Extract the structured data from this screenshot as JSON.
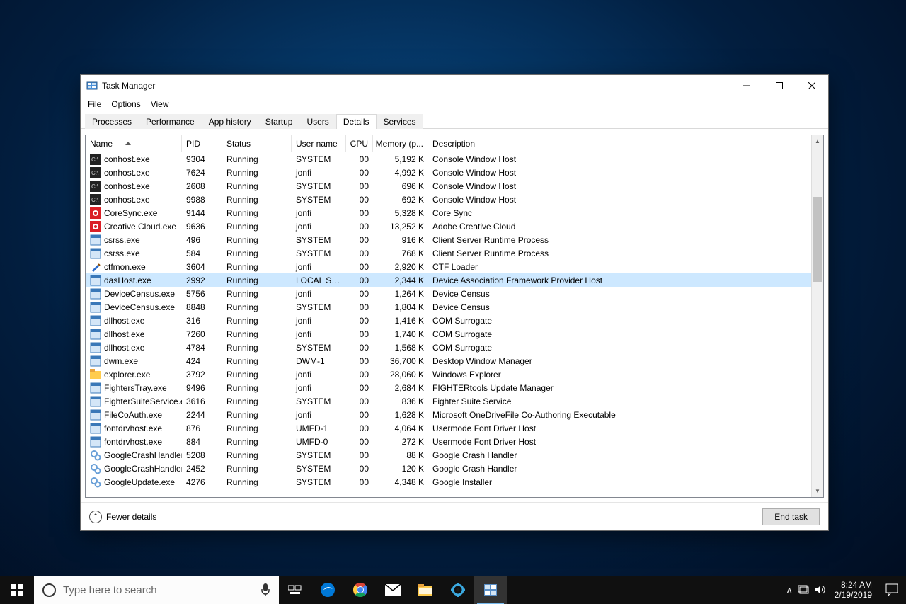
{
  "window": {
    "title": "Task Manager",
    "menu": [
      "File",
      "Options",
      "View"
    ],
    "tabs": [
      "Processes",
      "Performance",
      "App history",
      "Startup",
      "Users",
      "Details",
      "Services"
    ],
    "active_tab": 5,
    "columns": [
      "Name",
      "PID",
      "Status",
      "User name",
      "CPU",
      "Memory (p...",
      "Description"
    ],
    "sort_col": 0,
    "selected_row": 9,
    "fewer": "Fewer details",
    "end_task": "End task",
    "rows": [
      {
        "icon": "console",
        "name": "conhost.exe",
        "pid": "9304",
        "status": "Running",
        "user": "SYSTEM",
        "cpu": "00",
        "mem": "5,192 K",
        "desc": "Console Window Host"
      },
      {
        "icon": "console",
        "name": "conhost.exe",
        "pid": "7624",
        "status": "Running",
        "user": "jonfi",
        "cpu": "00",
        "mem": "4,992 K",
        "desc": "Console Window Host"
      },
      {
        "icon": "console",
        "name": "conhost.exe",
        "pid": "2608",
        "status": "Running",
        "user": "SYSTEM",
        "cpu": "00",
        "mem": "696 K",
        "desc": "Console Window Host"
      },
      {
        "icon": "console",
        "name": "conhost.exe",
        "pid": "9988",
        "status": "Running",
        "user": "SYSTEM",
        "cpu": "00",
        "mem": "692 K",
        "desc": "Console Window Host"
      },
      {
        "icon": "adobe-red",
        "name": "CoreSync.exe",
        "pid": "9144",
        "status": "Running",
        "user": "jonfi",
        "cpu": "00",
        "mem": "5,328 K",
        "desc": "Core Sync"
      },
      {
        "icon": "adobe-red",
        "name": "Creative Cloud.exe",
        "pid": "9636",
        "status": "Running",
        "user": "jonfi",
        "cpu": "00",
        "mem": "13,252 K",
        "desc": "Adobe Creative Cloud"
      },
      {
        "icon": "generic",
        "name": "csrss.exe",
        "pid": "496",
        "status": "Running",
        "user": "SYSTEM",
        "cpu": "00",
        "mem": "916 K",
        "desc": "Client Server Runtime Process"
      },
      {
        "icon": "generic",
        "name": "csrss.exe",
        "pid": "584",
        "status": "Running",
        "user": "SYSTEM",
        "cpu": "00",
        "mem": "768 K",
        "desc": "Client Server Runtime Process"
      },
      {
        "icon": "pen",
        "name": "ctfmon.exe",
        "pid": "3604",
        "status": "Running",
        "user": "jonfi",
        "cpu": "00",
        "mem": "2,920 K",
        "desc": "CTF Loader"
      },
      {
        "icon": "generic",
        "name": "dasHost.exe",
        "pid": "2992",
        "status": "Running",
        "user": "LOCAL SE...",
        "cpu": "00",
        "mem": "2,344 K",
        "desc": "Device Association Framework Provider Host"
      },
      {
        "icon": "generic",
        "name": "DeviceCensus.exe",
        "pid": "5756",
        "status": "Running",
        "user": "jonfi",
        "cpu": "00",
        "mem": "1,264 K",
        "desc": "Device Census"
      },
      {
        "icon": "generic",
        "name": "DeviceCensus.exe",
        "pid": "8848",
        "status": "Running",
        "user": "SYSTEM",
        "cpu": "00",
        "mem": "1,804 K",
        "desc": "Device Census"
      },
      {
        "icon": "generic",
        "name": "dllhost.exe",
        "pid": "316",
        "status": "Running",
        "user": "jonfi",
        "cpu": "00",
        "mem": "1,416 K",
        "desc": "COM Surrogate"
      },
      {
        "icon": "generic",
        "name": "dllhost.exe",
        "pid": "7260",
        "status": "Running",
        "user": "jonfi",
        "cpu": "00",
        "mem": "1,740 K",
        "desc": "COM Surrogate"
      },
      {
        "icon": "generic",
        "name": "dllhost.exe",
        "pid": "4784",
        "status": "Running",
        "user": "SYSTEM",
        "cpu": "00",
        "mem": "1,568 K",
        "desc": "COM Surrogate"
      },
      {
        "icon": "generic",
        "name": "dwm.exe",
        "pid": "424",
        "status": "Running",
        "user": "DWM-1",
        "cpu": "00",
        "mem": "36,700 K",
        "desc": "Desktop Window Manager"
      },
      {
        "icon": "folder",
        "name": "explorer.exe",
        "pid": "3792",
        "status": "Running",
        "user": "jonfi",
        "cpu": "00",
        "mem": "28,060 K",
        "desc": "Windows Explorer"
      },
      {
        "icon": "generic",
        "name": "FightersTray.exe",
        "pid": "9496",
        "status": "Running",
        "user": "jonfi",
        "cpu": "00",
        "mem": "2,684 K",
        "desc": "FIGHTERtools Update Manager"
      },
      {
        "icon": "generic",
        "name": "FighterSuiteService.e...",
        "pid": "3616",
        "status": "Running",
        "user": "SYSTEM",
        "cpu": "00",
        "mem": "836 K",
        "desc": "Fighter Suite Service"
      },
      {
        "icon": "generic",
        "name": "FileCoAuth.exe",
        "pid": "2244",
        "status": "Running",
        "user": "jonfi",
        "cpu": "00",
        "mem": "1,628 K",
        "desc": "Microsoft OneDriveFile Co-Authoring Executable"
      },
      {
        "icon": "generic",
        "name": "fontdrvhost.exe",
        "pid": "876",
        "status": "Running",
        "user": "UMFD-1",
        "cpu": "00",
        "mem": "4,064 K",
        "desc": "Usermode Font Driver Host"
      },
      {
        "icon": "generic",
        "name": "fontdrvhost.exe",
        "pid": "884",
        "status": "Running",
        "user": "UMFD-0",
        "cpu": "00",
        "mem": "272 K",
        "desc": "Usermode Font Driver Host"
      },
      {
        "icon": "gears",
        "name": "GoogleCrashHandler...",
        "pid": "5208",
        "status": "Running",
        "user": "SYSTEM",
        "cpu": "00",
        "mem": "88 K",
        "desc": "Google Crash Handler"
      },
      {
        "icon": "gears",
        "name": "GoogleCrashHandler...",
        "pid": "2452",
        "status": "Running",
        "user": "SYSTEM",
        "cpu": "00",
        "mem": "120 K",
        "desc": "Google Crash Handler"
      },
      {
        "icon": "gears",
        "name": "GoogleUpdate.exe",
        "pid": "4276",
        "status": "Running",
        "user": "SYSTEM",
        "cpu": "00",
        "mem": "4,348 K",
        "desc": "Google Installer"
      }
    ]
  },
  "taskbar": {
    "search_placeholder": "Type here to search",
    "time": "8:24 AM",
    "date": "2/19/2019"
  }
}
